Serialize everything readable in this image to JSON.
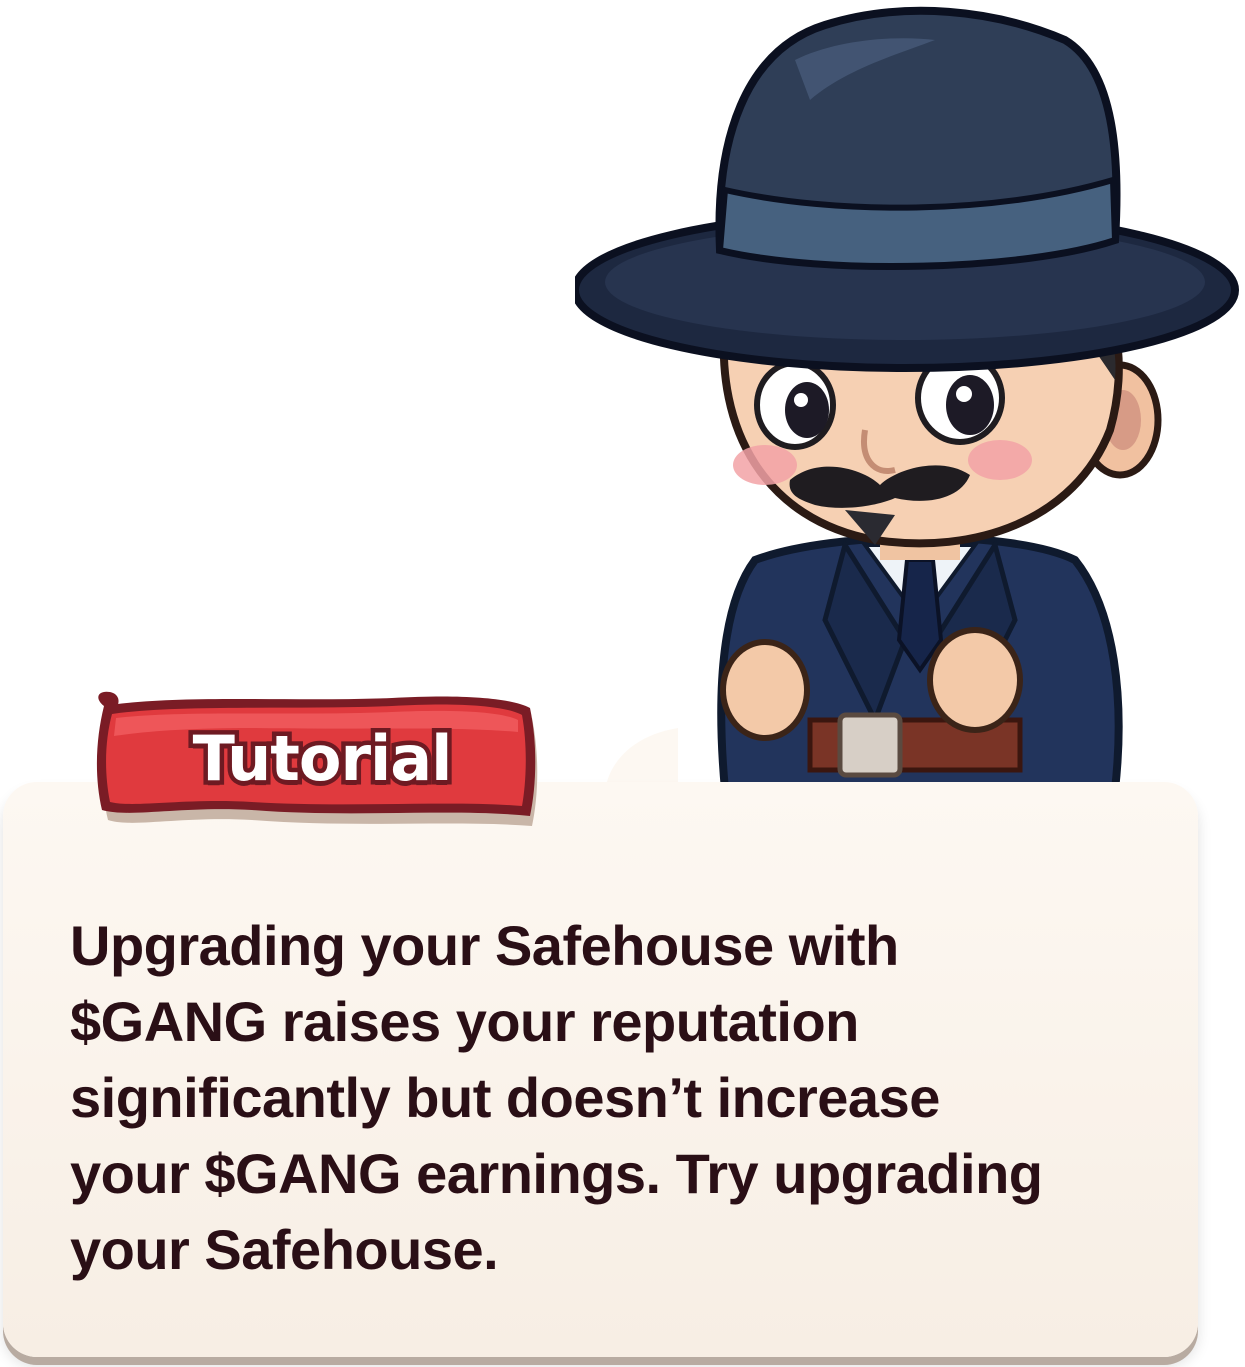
{
  "tutorial": {
    "title": "Tutorial",
    "message": "Upgrading your Safehouse with $GANG raises your reputation significantly but doesn’t increase your $GANG earnings. Try upgrading your Safehouse."
  },
  "character": {
    "icon": "gangster-detective-character-icon"
  },
  "colors": {
    "ribbon": "#e03a3e",
    "ribbon_dark": "#6e1a22",
    "card": "#fbf4ec",
    "text": "#2a0f16",
    "hat": "#2f3e57",
    "suit": "#22345c"
  }
}
